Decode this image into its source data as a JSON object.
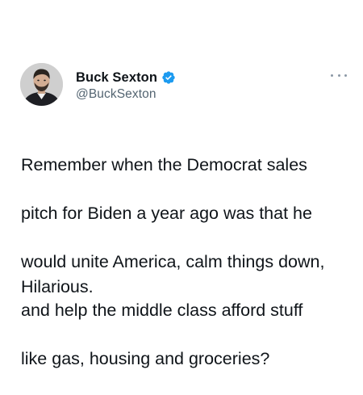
{
  "author": {
    "display_name": "Buck Sexton",
    "handle": "@BuckSexton",
    "verified": true,
    "avatar_icon": "profile-photo"
  },
  "menu_icon": "more-dots-icon",
  "tweet": {
    "lines": [
      "Remember when the Democrat sales",
      "pitch for Biden a year ago was that he",
      "would unite America, calm things down,",
      "and help the middle class afford stuff",
      "like gas, housing and groceries?"
    ],
    "closing": "Hilarious."
  },
  "colors": {
    "text": "#0f1419",
    "handle": "#536471",
    "verified": "#1d9bf0"
  }
}
